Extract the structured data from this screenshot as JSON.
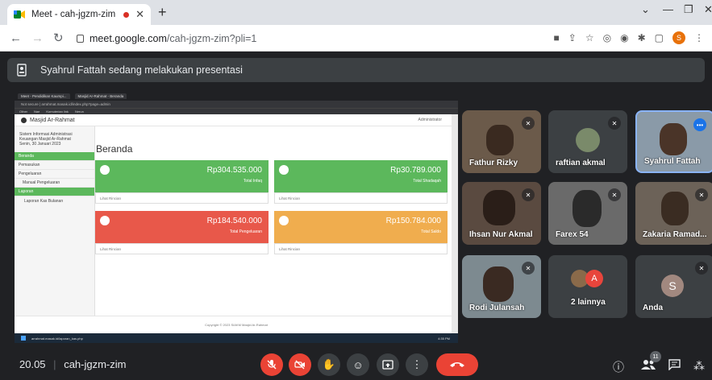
{
  "browser": {
    "tab_title": "Meet - cah-jgzm-zim",
    "new_tab": "+",
    "url_host": "meet.google.com",
    "url_path": "/cah-jgzm-zim?pli=1"
  },
  "banner": {
    "text": "Syahrul Fattah sedang melakukan presentasi"
  },
  "shared_screen": {
    "inner_tabs": [
      "Meet - Pendidikan Kaumpi...",
      "Masjid Ar-Rahmat - Beranda"
    ],
    "inner_url": "Not secure | arrahmat.masak.id/index.php?page=admin",
    "bookmarks": [
      "Other",
      "Nae",
      "Komuterian link",
      "Nerun"
    ],
    "app_title": "Masjid Ar-Rahmat",
    "admin_label": "Administrator",
    "sidebar_info": [
      "Sistem Informasi Administrasi",
      "Keuangan Masjid Ar-Rahmat",
      "Senin, 30 Januari 2023"
    ],
    "menu": [
      "Beranda",
      "Pemasukan",
      "Pengeluaran",
      "Manual Pengeluaran",
      "Laporan",
      "Laporan Kas Bulanan"
    ],
    "page_heading": "Beranda",
    "cards": [
      {
        "amount": "Rp304.535.000",
        "label": "Total Infaq",
        "color": "#5cb85c",
        "footer": "Lihat Rincian"
      },
      {
        "amount": "Rp30.789.000",
        "label": "Total Shadaqah",
        "color": "#5cb85c",
        "footer": "Lihat Rincian"
      },
      {
        "amount": "Rp184.540.000",
        "label": "Total Pengeluaran",
        "color": "#e8584a",
        "footer": "Lihat Rincian"
      },
      {
        "amount": "Rp150.784.000",
        "label": "Total Saldo",
        "color": "#f0ad4e",
        "footer": "Lihat Rincian"
      }
    ],
    "footer": "Copyright © 2023 SIAKM Masjid Ar-Rahmat",
    "status_url": "arrahmat.masak.id/laporan_kas.php",
    "clock": "4:35 PM"
  },
  "participants": [
    {
      "name": "Fathur Rizky"
    },
    {
      "name": "raftian akmal"
    },
    {
      "name": "Syahrul Fattah"
    },
    {
      "name": "Ihsan Nur Akmal"
    },
    {
      "name": "Farex 54"
    },
    {
      "name": "Zakaria Ramad..."
    },
    {
      "name": "Rodi Julansah"
    },
    {
      "name": "2 lainnya",
      "initial": "A"
    },
    {
      "name": "Anda",
      "initial": "S"
    }
  ],
  "bottom_bar": {
    "time": "20.05",
    "separator": "|",
    "meeting_code": "cah-jgzm-zim",
    "people_count": "11"
  },
  "colors": {
    "danger": "#ea4335",
    "surface": "#3c4043",
    "background": "#202124"
  }
}
